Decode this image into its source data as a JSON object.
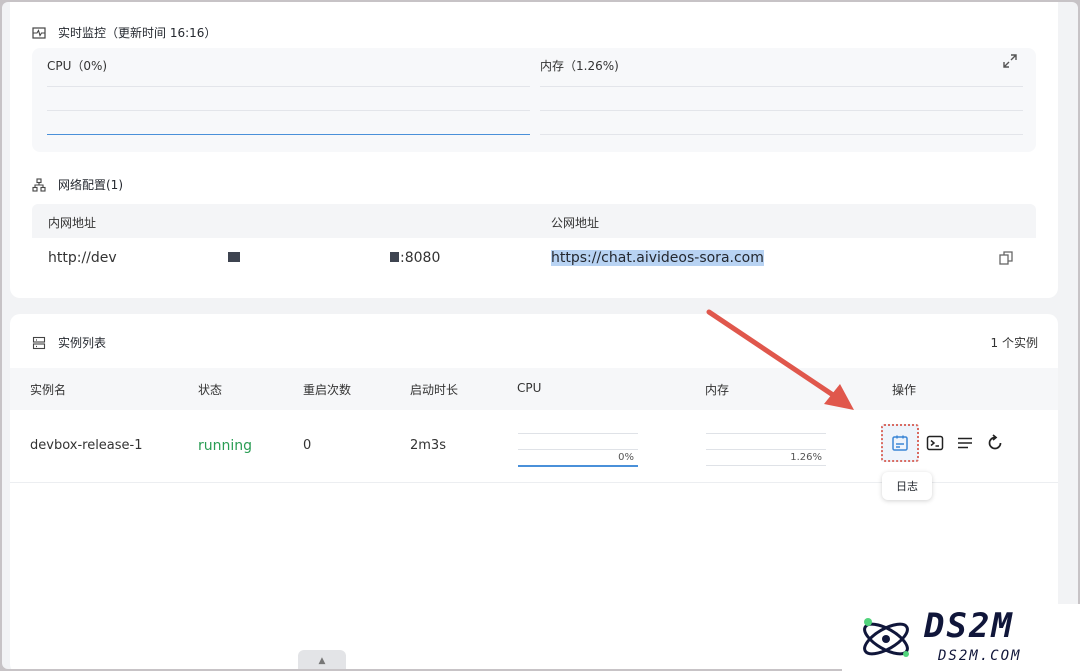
{
  "monitor": {
    "title": "实时监控（更新时间 16:16）",
    "cpu_label": "CPU（0%)",
    "mem_label": "内存（1.26%)"
  },
  "network": {
    "title": "网络配置(1)",
    "headers": [
      "内网地址",
      "公网地址"
    ],
    "internal_start": "http://dev",
    "internal_end": ":8080",
    "public_url": "https://chat.aivideos-sora.com"
  },
  "instances": {
    "title": "实例列表",
    "count": "1 个实例",
    "columns": [
      "实例名",
      "状态",
      "重启次数",
      "启动时长",
      "CPU",
      "内存",
      "操作"
    ],
    "row": {
      "name": "devbox-release-1",
      "status": "running",
      "restarts": "0",
      "uptime": "2m3s",
      "cpu": "0%",
      "mem": "1.26%"
    },
    "tooltip": "日志"
  },
  "watermark": {
    "big": "DS2M",
    "small": "DS2M.COM"
  },
  "colors": {
    "accent_blue": "#4a90d9",
    "running_green": "#2a9d54",
    "arrow_red": "#e0574c"
  }
}
